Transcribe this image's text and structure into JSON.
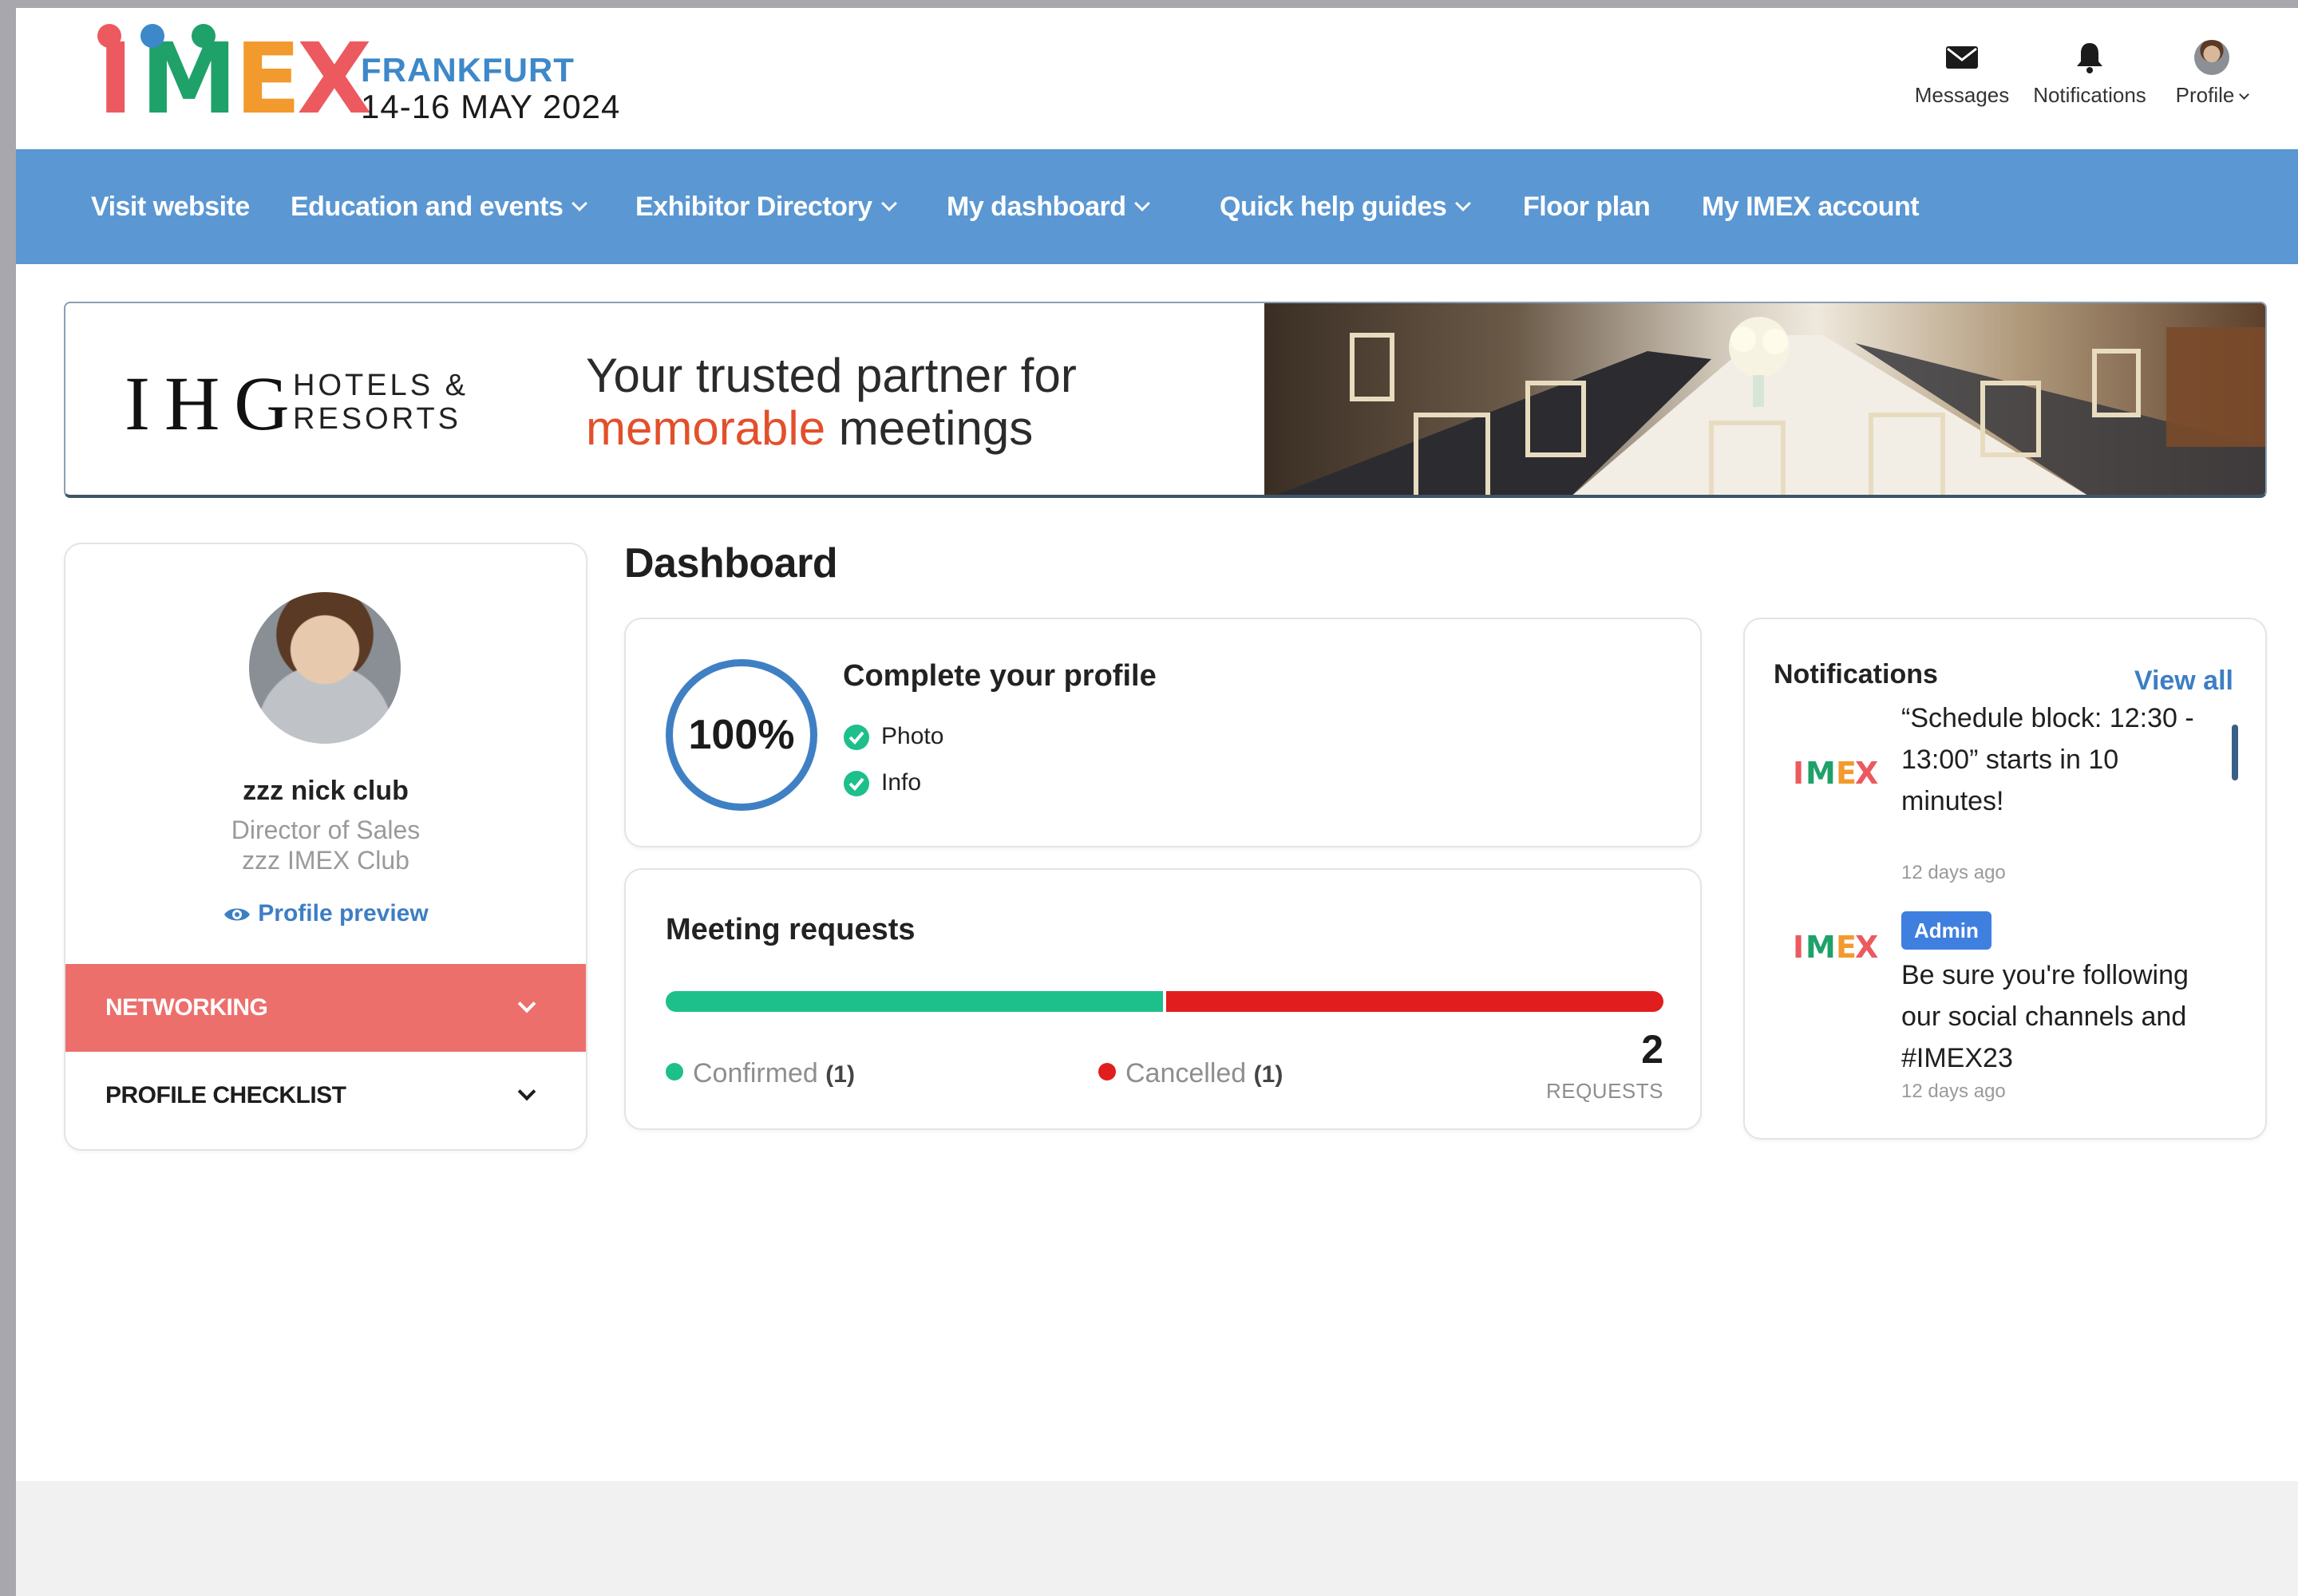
{
  "header": {
    "logo": {
      "word": "IMEX",
      "city": "FRANKFURT",
      "dates": "14-16 MAY 2024"
    },
    "actions": [
      {
        "label": "Messages",
        "icon": "envelope-icon"
      },
      {
        "label": "Notifications",
        "icon": "bell-icon"
      },
      {
        "label": "Profile",
        "icon": "avatar"
      }
    ]
  },
  "nav": {
    "items": [
      {
        "label": "Visit website",
        "dropdown": false
      },
      {
        "label": "Education and events",
        "dropdown": true
      },
      {
        "label": "Exhibitor Directory",
        "dropdown": true
      },
      {
        "label": "My dashboard",
        "dropdown": true
      },
      {
        "label": "Quick help guides",
        "dropdown": true
      },
      {
        "label": "Floor plan",
        "dropdown": false
      },
      {
        "label": "My IMEX account",
        "dropdown": false
      }
    ]
  },
  "banner": {
    "brand": "IHG",
    "brand_sub_1": "HOTELS &",
    "brand_sub_2": "RESORTS",
    "tagline_1": "Your trusted partner for",
    "tagline_accent": "memorable",
    "tagline_2": " meetings"
  },
  "profile": {
    "name": "zzz nick club",
    "role": "Director of Sales",
    "organization": "zzz IMEX Club",
    "preview_label": "Profile preview",
    "sections": [
      {
        "label": "NETWORKING"
      },
      {
        "label": "PROFILE CHECKLIST"
      }
    ]
  },
  "dashboard": {
    "title": "Dashboard",
    "completion": {
      "percent_label": "100%",
      "percent": 100,
      "title": "Complete your profile",
      "items": [
        "Photo",
        "Info"
      ]
    },
    "meetings": {
      "title": "Meeting requests",
      "confirmed_label": "Confirmed",
      "confirmed_count": "(1)",
      "cancelled_label": "Cancelled",
      "cancelled_count": "(1)",
      "confirmed_value": 1,
      "cancelled_value": 1,
      "total": "2",
      "total_label": "REQUESTS"
    }
  },
  "notifications": {
    "title": "Notifications",
    "view_all": "View all",
    "items": [
      {
        "text": "“Schedule block: 12:30 - 13:00” starts in 10 minutes!",
        "time": "12 days ago",
        "badge": ""
      },
      {
        "text": "Be sure you're following our social channels and #IMEX23",
        "time": "12 days ago",
        "badge": "Admin"
      }
    ]
  },
  "colors": {
    "nav_bg": "#5b97d2",
    "networking_bg": "#ec6f6c",
    "link": "#3d7ec4",
    "confirmed": "#1dbf8a",
    "cancelled": "#e11d1d",
    "ring": "#3f80c4"
  }
}
